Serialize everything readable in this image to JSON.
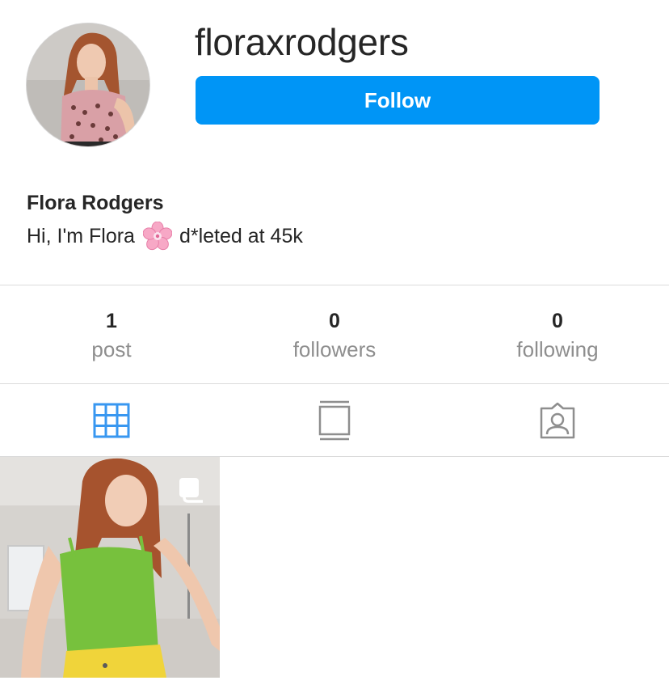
{
  "profile": {
    "username": "floraxrodgers",
    "full_name": "Flora Rodgers",
    "bio_before": "Hi, I'm Flora",
    "bio_emoji": "cherry-blossom-emoji",
    "bio_after": "d*leted at 45k",
    "follow_label": "Follow"
  },
  "stats": [
    {
      "value": "1",
      "label": "post"
    },
    {
      "value": "0",
      "label": "followers"
    },
    {
      "value": "0",
      "label": "following"
    }
  ],
  "tabs": [
    {
      "icon": "grid-icon",
      "active": true
    },
    {
      "icon": "guide-icon",
      "active": false
    },
    {
      "icon": "tagged-icon",
      "active": false
    }
  ],
  "posts": [
    {
      "kind": "carousel",
      "icon": "multiple-photos-icon"
    }
  ],
  "colors": {
    "accent": "#0095f6",
    "active_tab": "#3897f0",
    "inactive_tab": "#8e8e8e",
    "divider": "#dbdbdb"
  }
}
